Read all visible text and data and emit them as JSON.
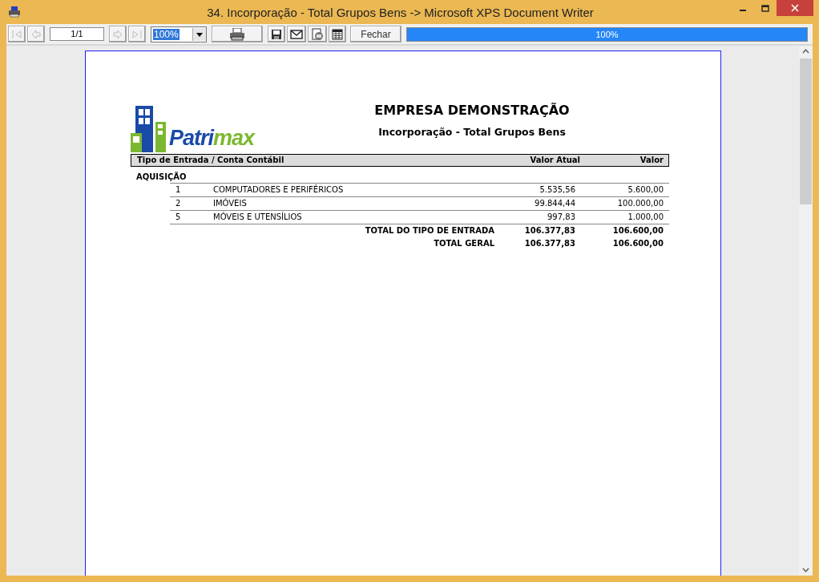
{
  "window": {
    "title": "34. Incorporação - Total Grupos Bens -> Microsoft XPS Document Writer"
  },
  "toolbar": {
    "first_disabled": true,
    "prev_disabled": true,
    "page": "1/1",
    "next_disabled": true,
    "last_disabled": true,
    "zoom": "100%",
    "close_button": "Fechar",
    "progress": {
      "level": 1,
      "reading": "100%"
    }
  },
  "report": {
    "logo": {
      "parts": [
        "Patri",
        "max"
      ]
    },
    "company": "EMPRESA DEMONSTRAÇÃO",
    "title": "Incorporação - Total Grupos Bens",
    "columns": [
      "Tipo de Entrada / Conta Contábil",
      "Valor Atual",
      "Valor"
    ],
    "group": "AQUISIÇÃO",
    "rows": [
      {
        "code": "1",
        "name": "COMPUTADORES E PERIFÉRICOS",
        "valor_atual": "5.535,56",
        "valor": "5.600,00"
      },
      {
        "code": "2",
        "name": "IMÓVEIS",
        "valor_atual": "99.844,44",
        "valor": "100.000,00"
      },
      {
        "code": "5",
        "name": "MÓVEIS E UTENSÍLIOS",
        "valor_atual": "997,83",
        "valor": "1.000,00"
      }
    ],
    "totals": [
      {
        "label": "TOTAL DO TIPO DE ENTRADA",
        "valor_atual": "106.377,83",
        "valor": "106.600,00"
      },
      {
        "label": "TOTAL GERAL",
        "valor_atual": "106.377,83",
        "valor": "106.600,00"
      }
    ]
  }
}
